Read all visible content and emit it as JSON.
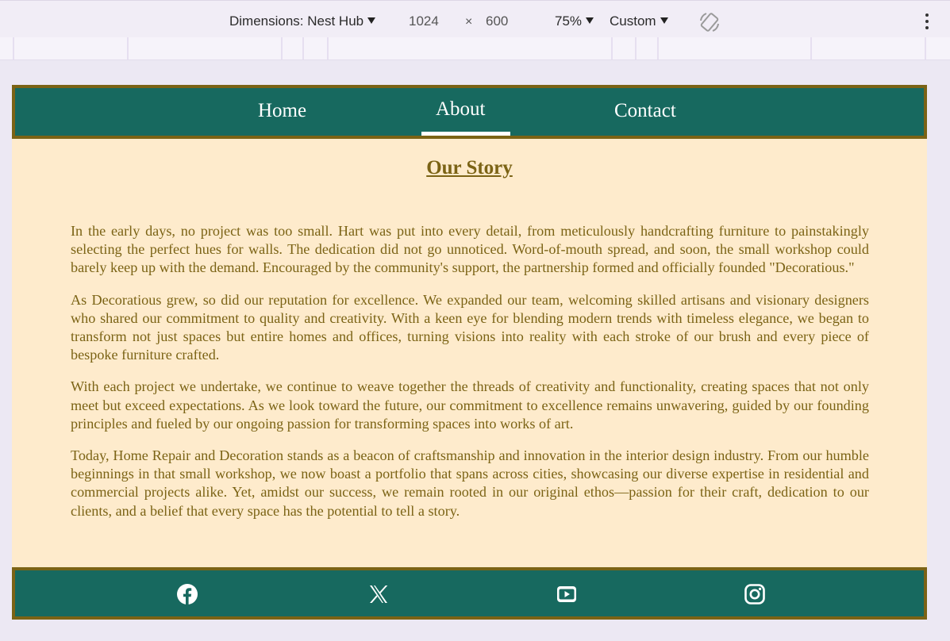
{
  "devtools": {
    "dimensions_label": "Dimensions: Nest Hub",
    "width": "1024",
    "times": "×",
    "height": "600",
    "zoom": "75%",
    "throttle": "Custom"
  },
  "nav": {
    "items": [
      {
        "label": "Home"
      },
      {
        "label": "About"
      },
      {
        "label": "Contact"
      }
    ],
    "active": "About"
  },
  "story": {
    "title": "Our Story",
    "paragraphs": [
      "In the early days, no project was too small. Hart was put into every detail, from meticulously handcrafting furniture to painstakingly selecting the perfect hues for walls. The dedication did not go unnoticed. Word-of-mouth spread, and soon, the small workshop could barely keep up with the demand. Encouraged by the community's support, the partnership formed and officially founded \"Decoratious.\"",
      "As Decoratious grew, so did our reputation for excellence. We expanded our team, welcoming skilled artisans and visionary designers who shared our commitment to quality and creativity. With a keen eye for blending modern trends with timeless elegance, we began to transform not just spaces but entire homes and offices, turning visions into reality with each stroke of our brush and every piece of bespoke furniture crafted.",
      "With each project we undertake, we continue to weave together the threads of creativity and functionality, creating spaces that not only meet but exceed expectations. As we look toward the future, our commitment to excellence remains unwavering, guided by our founding principles and fueled by our ongoing passion for transforming spaces into works of art.",
      "Today, Home Repair and Decoration stands as a beacon of craftsmanship and innovation in the interior design industry. From our humble beginnings in that small workshop, we now boast a portfolio that spans across cities, showcasing our diverse expertise in residential and commercial projects alike. Yet, amidst our success, we remain rooted in our original ethos—passion for their craft, dedication to our clients, and a belief that every space has the potential to tell a story."
    ]
  },
  "footer": {
    "icons": [
      "facebook-icon",
      "x-icon",
      "youtube-icon",
      "instagram-icon"
    ]
  },
  "colors": {
    "nav_bg": "#17695f",
    "border": "#7b6315",
    "page_bg": "#feebcc",
    "text": "#7b6315"
  }
}
